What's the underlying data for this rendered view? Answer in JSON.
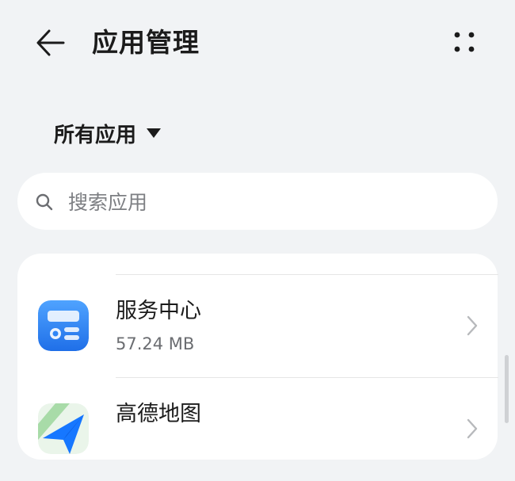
{
  "header": {
    "title": "应用管理"
  },
  "filter": {
    "label": "所有应用"
  },
  "search": {
    "placeholder": "搜索应用"
  },
  "apps": [
    {
      "name": "服务中心",
      "size": "57.24 MB",
      "icon": "service-center-icon"
    },
    {
      "name": "高德地图",
      "size": "",
      "icon": "amap-icon"
    }
  ],
  "colors": {
    "background": "#f1f3f5",
    "card": "#ffffff",
    "service_blue": "#2f86f6"
  }
}
